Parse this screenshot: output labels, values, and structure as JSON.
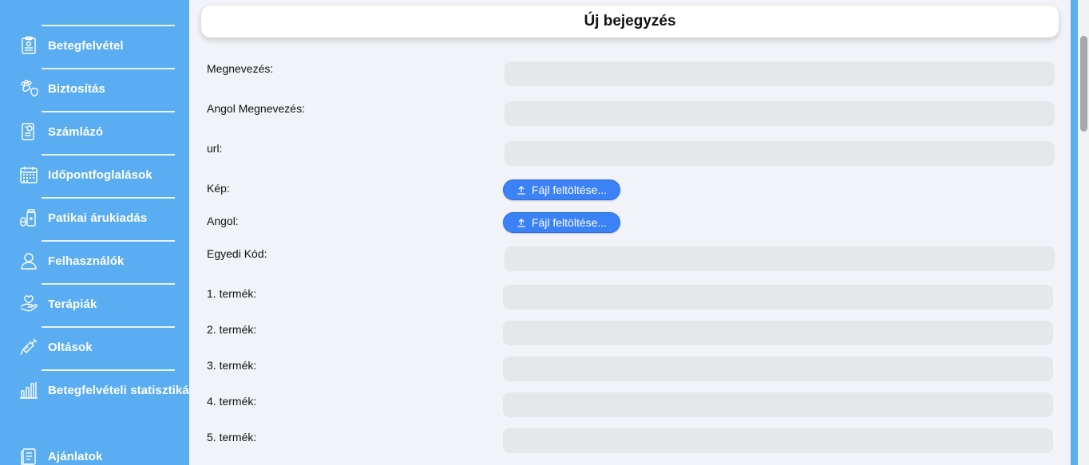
{
  "sidebar": {
    "items": [
      {
        "label": "Betegfelvétel",
        "icon": "clipboard-icon"
      },
      {
        "label": "Biztosítás",
        "icon": "paw-shield-icon"
      },
      {
        "label": "Számlázó",
        "icon": "invoice-icon"
      },
      {
        "label": "Időpontfoglalások",
        "icon": "calendar-icon"
      },
      {
        "label": "Patikai árukiadás",
        "icon": "medicine-icon"
      },
      {
        "label": "Felhasználók",
        "icon": "user-icon"
      },
      {
        "label": "Terápiák",
        "icon": "hand-heart-icon"
      },
      {
        "label": "Oltások",
        "icon": "syringe-icon"
      },
      {
        "label": "Betegfelvételi statisztikák",
        "icon": "bar-chart-icon"
      },
      {
        "label": "Ajánlatok",
        "icon": "document-icon"
      }
    ]
  },
  "header": {
    "title": "Új bejegyzés"
  },
  "form": {
    "name_label": "Megnevezés:",
    "name_value": "",
    "english_name_label": "Angol Megnevezés:",
    "english_name_value": "",
    "url_label": "url:",
    "url_value": "",
    "image_label": "Kép:",
    "english_label": "Angol:",
    "upload_label": "Fájl feltöltése...",
    "unique_code_label": "Egyedi Kód:",
    "unique_code_value": "",
    "product_1_label": "1. termék:",
    "product_1_value": "",
    "product_2_label": "2. termék:",
    "product_2_value": "",
    "product_3_label": "3. termék:",
    "product_3_value": "",
    "product_4_label": "4. termék:",
    "product_4_value": "",
    "product_5_label": "5. termék:",
    "product_5_value": ""
  },
  "colors": {
    "sidebar_bg": "#5aadf1",
    "main_bg": "#f1f3f8",
    "input_bg": "#e6e7eb",
    "button_bg": "#3b82f6"
  }
}
